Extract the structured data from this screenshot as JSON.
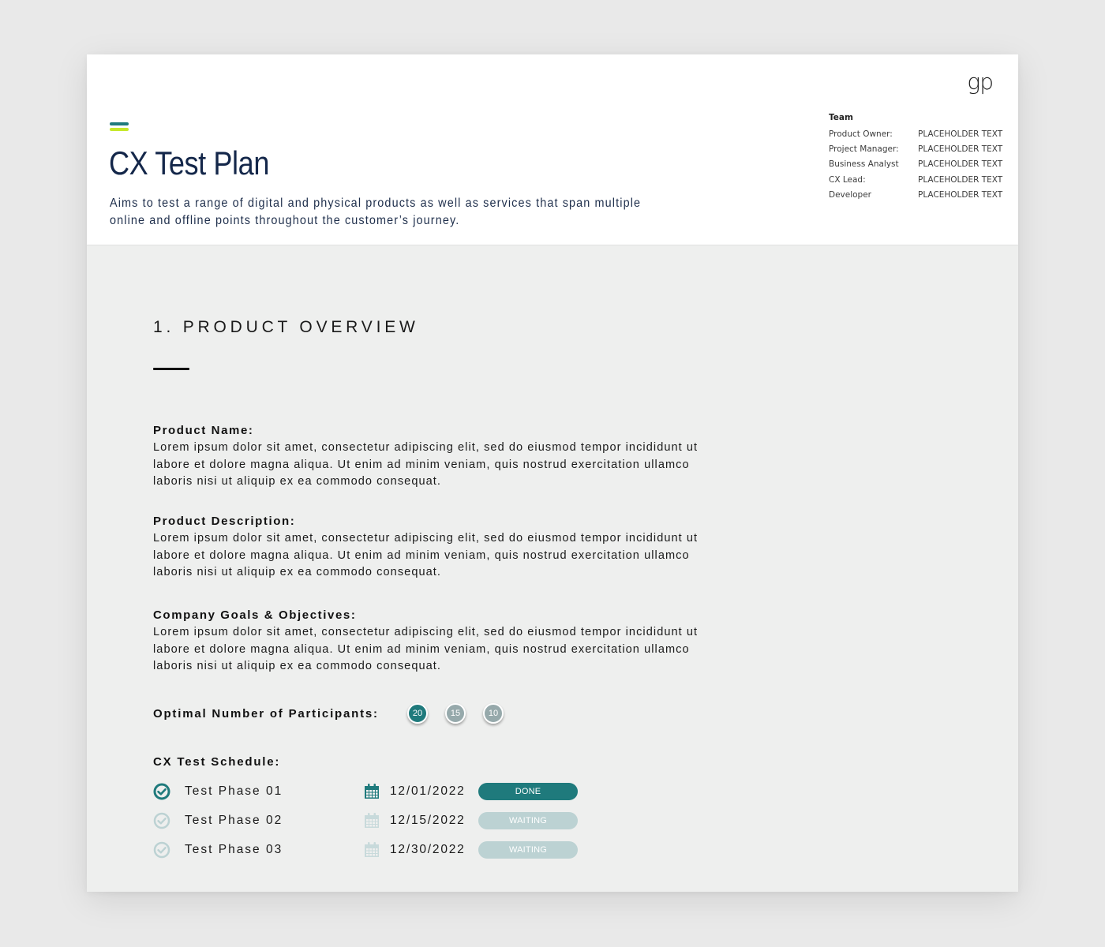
{
  "header": {
    "logo": "gp",
    "title": "CX Test Plan",
    "subtitle": "Aims to test a range of digital and physical products as well as services that span multiple online and offline points throughout the customer’s journey.",
    "team": {
      "title": "Team",
      "members": [
        {
          "role": "Product Owner:",
          "value": "PLACEHOLDER TEXT"
        },
        {
          "role": "Project Manager:",
          "value": "PLACEHOLDER TEXT"
        },
        {
          "role": "Business Analyst",
          "value": "PLACEHOLDER TEXT"
        },
        {
          "role": "CX Lead:",
          "value": "PLACEHOLDER TEXT"
        },
        {
          "role": "Developer",
          "value": "PLACEHOLDER TEXT"
        }
      ]
    }
  },
  "colors": {
    "accent_primary": "#1f7a7c",
    "accent_secondary": "#c6e82b",
    "title": "#14274a",
    "inactive": "#bcd2d3"
  },
  "section": {
    "title": "1. PRODUCT OVERVIEW",
    "blocks": [
      {
        "label": "Product Name:",
        "text": "Lorem ipsum dolor sit amet, consectetur adipiscing elit, sed do eiusmod tempor incididunt ut labore et dolore magna aliqua. Ut enim ad minim veniam, quis nostrud exercitation ullamco laboris nisi ut aliquip ex ea commodo consequat."
      },
      {
        "label": "Product Description:",
        "text": "Lorem ipsum dolor sit amet, consectetur adipiscing elit, sed do eiusmod tempor incididunt ut labore et dolore magna aliqua. Ut enim ad minim veniam, quis nostrud exercitation ullamco laboris nisi ut aliquip ex ea commodo consequat."
      },
      {
        "label": "Company Goals & Objectives:",
        "text": "Lorem ipsum dolor sit amet, consectetur adipiscing elit, sed do eiusmod tempor incididunt ut labore et dolore magna aliqua. Ut enim ad minim veniam, quis nostrud exercitation ullamco laboris nisi ut aliquip ex ea commodo consequat."
      }
    ],
    "participants": {
      "label": "Optimal Number of Participants:",
      "options": [
        "20",
        "15",
        "10"
      ],
      "selected": "20"
    },
    "schedule": {
      "title": "CX Test Schedule:",
      "rows": [
        {
          "phase": "Test Phase 01",
          "date": "12/01/2022",
          "status": "DONE",
          "complete": true
        },
        {
          "phase": "Test Phase 02",
          "date": "12/15/2022",
          "status": "WAITING",
          "complete": false
        },
        {
          "phase": "Test Phase 03",
          "date": "12/30/2022",
          "status": "WAITING",
          "complete": false
        }
      ]
    }
  }
}
